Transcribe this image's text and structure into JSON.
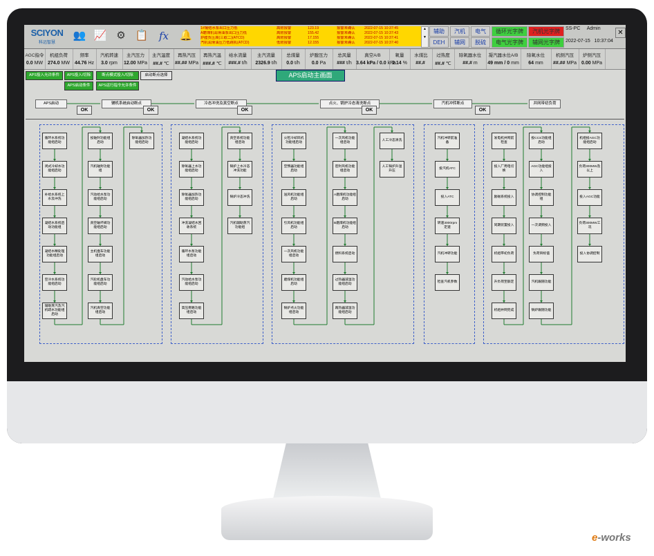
{
  "brand": {
    "logo": "SCIYON",
    "sub": "科远智慧"
  },
  "alarms": [
    {
      "msg": "1#凝结水泵出口压力低",
      "level": "高限报警",
      "value": "123.19",
      "state": "报警未确认",
      "time": "2022-07-15 10:37:45"
    },
    {
      "msg": "A磨煤机润滑油泵出口压力低",
      "level": "高限报警",
      "value": "155.42",
      "state": "报警未确认",
      "time": "2022-07-15 10:37:43"
    },
    {
      "msg": "炉膛负压高(三取二)(ATCD)",
      "level": "高限报警",
      "value": "17.155",
      "state": "报警未确认",
      "time": "2022-07-15 10:37:41"
    },
    {
      "msg": "汽机润滑油压力低跳机(ATCD)",
      "level": "低限报警",
      "value": "12.155",
      "state": "报警未确认",
      "time": "2022-07-15 10:37:40"
    }
  ],
  "nav": {
    "row1": [
      "辅助",
      "汽机",
      "电气",
      "循环光字牌",
      "汽机光字牌"
    ],
    "row2": [
      "DEH",
      "辅网",
      "脱硫",
      "电气光字牌",
      "辅网光字牌"
    ]
  },
  "user": {
    "station": "SS-PC",
    "name": "Admin",
    "date": "2022-07-15",
    "time": "10:37:04"
  },
  "params": [
    {
      "label": "AGC指令",
      "value": "0.0",
      "unit": "MW"
    },
    {
      "label": "机组负荷",
      "value": "274.0",
      "unit": "MW"
    },
    {
      "label": "频率",
      "value": "44.76",
      "unit": "Hz"
    },
    {
      "label": "汽机转速",
      "value": "3.0",
      "unit": "rpm"
    },
    {
      "label": "主汽压力",
      "value": "12.00",
      "unit": "MPa"
    },
    {
      "label": "主汽温度",
      "value": "##.#",
      "unit": "℃"
    },
    {
      "label": "再热汽压",
      "value": "##.##",
      "unit": "MPa"
    },
    {
      "label": "再热汽温",
      "value": "###.#",
      "unit": "℃"
    },
    {
      "label": "给水流量",
      "value": "###.#",
      "unit": "t/h"
    },
    {
      "label": "主汽流量",
      "value": "2326.9",
      "unit": "t/h"
    },
    {
      "label": "总煤量",
      "value": "0.0",
      "unit": "t/h"
    },
    {
      "label": "炉膛压力",
      "value": "0.0",
      "unit": "Pa"
    },
    {
      "label": "总风量",
      "value": "###",
      "unit": "t/h"
    },
    {
      "label": "真空A/B",
      "value": "3.64 kPa / 0.0",
      "unit": "kPa"
    },
    {
      "label": "氧量",
      "value": "2.14",
      "unit": "%"
    },
    {
      "label": "水煤比",
      "value": "##.#",
      "unit": ""
    },
    {
      "label": "过热度",
      "value": "##.#",
      "unit": "℃"
    },
    {
      "label": "除氧器水位",
      "value": "##.#",
      "unit": "m"
    },
    {
      "label": "凝汽器水位A/B",
      "value": "49 mm / 0",
      "unit": "mm"
    },
    {
      "label": "除氧水位",
      "value": "64",
      "unit": "mm"
    },
    {
      "label": "机侧汽压",
      "value": "##.##",
      "unit": "MPa"
    },
    {
      "label": "炉侧汽压",
      "value": "0.00",
      "unit": "MPa"
    }
  ],
  "control_buttons": [
    "APS投入允许条件",
    "APS投入/切除",
    "断点模式投入/切除",
    "启动断点选择",
    "APS启动条件",
    "APS运行指令允许条件"
  ],
  "title": "APS启动主画面",
  "seq": [
    {
      "label": "APS启动",
      "ok": "OK"
    },
    {
      "label": "辅机系统启动断点",
      "ok": "OK"
    },
    {
      "label": "冷态冲洗及真空断点",
      "ok": "OK"
    },
    {
      "label": "点火、锅炉冷态清洗断点",
      "ok": "OK"
    },
    {
      "label": "汽机冲转断点",
      "ok": "OK"
    },
    {
      "label": "并网带初负荷"
    }
  ],
  "groups": [
    {
      "cols": [
        [
          "循环水系统功能组启动",
          "闭式冷却水功能组启动",
          "补给水系统上水及冲洗",
          "凝结水系统启动功能组",
          "凝结水精处理功能组启动",
          "空冷水系统功能组启动",
          "辅助蒸汽及汽机疏水功能组启动"
        ],
        [
          "投轴封功能组启动",
          "汽机轴封功能组",
          "汽动给水泵功能组启动",
          "真空破坏阀功能组启动",
          "主机盘车功能组启动",
          "汽轮机盘车功能组启动",
          "汽机真空功能组启动"
        ],
        [
          "除氧器加热功能组启动"
        ]
      ]
    },
    {
      "cols": [
        [
          "凝结水系统功能组启动",
          "除氧器上水功能组启动",
          "除氧器加热功能组启动",
          "冲洗凝结水回收系统",
          "循环水泵功能组启动",
          "汽动给水泵功能组启动",
          "高压旁路功能组启动"
        ],
        [
          "真空系统功能组启动",
          "锅炉上水冷态冲洗功能",
          "锅炉冷态冲洗",
          "汽机辅助蒸汽功能组"
        ]
      ]
    },
    {
      "cols": [
        [
          "火检冷却风机功能组启动",
          "空预器功能组启动",
          "送风机功能组启动",
          "引风机功能组启动",
          "一次风机功能组启动",
          "磨煤机功能组启动",
          "锅炉点火功能组启动"
        ],
        [
          "一次风机功能组启动",
          "密封风机功能组启动",
          "A磨煤机功能组启动",
          "B磨煤机功能组启动",
          "燃料系统启动",
          "过热器减温功能组启动",
          "再热器减温功能组启动"
        ],
        [
          "人工冷态清洗",
          "人工锅炉升温升压"
        ]
      ]
    },
    {
      "cols": [
        [
          "汽机冲转前准备",
          "投汽机ATC",
          "投入ATC",
          "转速3000rpm定速",
          "汽机冲转功能",
          "检查汽机参数"
        ]
      ]
    },
    {
      "cols": [
        [
          "发电机并网前检查",
          "投入厂用电切换",
          "励磁系统投入",
          "同期装置投入",
          "机组带初负荷",
          "升负荷至额定",
          "机组并网完成"
        ],
        [
          "投CCS功能组启动",
          "AGC功能组投入",
          "协调控制功能组",
          "一次调频投入",
          "负荷目标值",
          "汽机跟随功能",
          "锅炉跟随功能"
        ],
        [
          "机组投AGC功能组启动",
          "负荷300MW及以上",
          "投入AGC功能",
          "负荷300MW工况",
          "投入协调控制"
        ]
      ]
    }
  ]
}
